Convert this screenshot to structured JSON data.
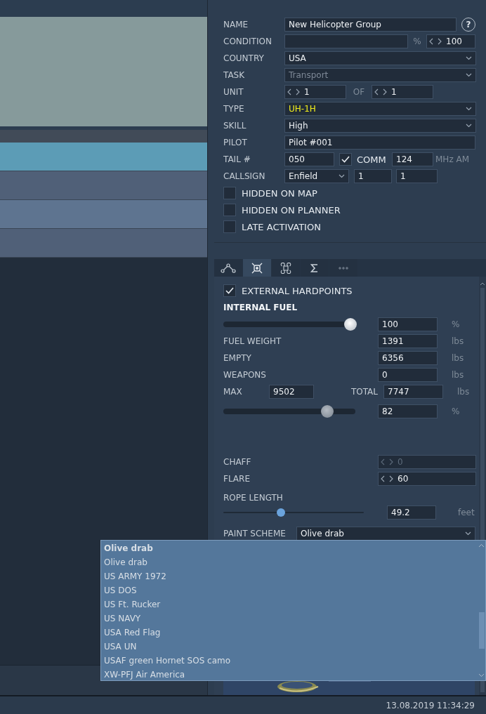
{
  "list_rows": [
    {
      "selected": true
    },
    {
      "selected": false
    },
    {
      "selected": false
    },
    {
      "selected": false
    }
  ],
  "group_form": {
    "name": {
      "label": "NAME",
      "value": "New Helicopter Group",
      "help": "?"
    },
    "condition": {
      "label": "CONDITION",
      "unit": "%",
      "spinner": "100"
    },
    "country": {
      "label": "COUNTRY",
      "value": "USA"
    },
    "task": {
      "label": "TASK",
      "value": "Transport",
      "disabled": true
    },
    "unit": {
      "label": "UNIT",
      "value": "1",
      "of_label": "OF",
      "of_value": "1"
    },
    "type": {
      "label": "TYPE",
      "value": "UH-1H",
      "highlighted": true
    },
    "skill": {
      "label": "SKILL",
      "value": "High"
    },
    "pilot": {
      "label": "PILOT",
      "value": "Pilot #001"
    },
    "tail": {
      "label": "TAIL #",
      "value": "050"
    },
    "comm": {
      "label": "COMM",
      "checked": true,
      "value": "124",
      "unit": "MHz AM"
    },
    "callsign": {
      "label": "CALLSIGN",
      "value": "Enfield",
      "number_1": "1",
      "number_2": "1"
    },
    "options": [
      {
        "label": "HIDDEN ON MAP",
        "checked": false
      },
      {
        "label": "HIDDEN ON PLANNER",
        "checked": false
      },
      {
        "label": "LATE ACTIVATION",
        "checked": false
      }
    ]
  },
  "tabs": [
    {
      "kind": "route",
      "selected": false
    },
    {
      "kind": "payload",
      "selected": true
    },
    {
      "kind": "command",
      "selected": false
    },
    {
      "kind": "sum",
      "selected": false
    },
    {
      "kind": "more",
      "selected": false
    }
  ],
  "payload": {
    "external_hardpoints": {
      "label": "EXTERNAL HARDPOINTS",
      "checked": true
    },
    "internal_fuel": {
      "title": "INTERNAL FUEL",
      "level": 1.0,
      "value": "100",
      "unit": "%"
    },
    "rows": [
      {
        "label": "FUEL WEIGHT",
        "value": "1391",
        "unit": "lbs"
      },
      {
        "label": "EMPTY",
        "value": "6356",
        "unit": "lbs"
      },
      {
        "label": "WEAPONS",
        "value": "0",
        "unit": "lbs"
      }
    ],
    "max": {
      "label": "MAX",
      "value": "9502"
    },
    "total": {
      "label": "TOTAL",
      "value": "7747",
      "unit": "lbs"
    },
    "load": {
      "level": 0.82,
      "value": "82",
      "unit": "%"
    },
    "chaff": {
      "label": "CHAFF",
      "value": "0",
      "disabled": true
    },
    "flare": {
      "label": "FLARE",
      "value": "60",
      "disabled": false
    },
    "rope": {
      "label": "ROPE LENGTH",
      "level": 0.4,
      "value": "49.2",
      "unit": "feet"
    },
    "paint_scheme": {
      "label": "PAINT SCHEME",
      "value": "Olive drab"
    }
  },
  "paint_dropdown": {
    "options": [
      {
        "label": "Olive drab",
        "selected": true
      },
      {
        "label": "Olive drab",
        "selected": false
      },
      {
        "label": "US ARMY 1972",
        "selected": false
      },
      {
        "label": "US DOS",
        "selected": false
      },
      {
        "label": "US Ft. Rucker",
        "selected": false
      },
      {
        "label": "US NAVY",
        "selected": false
      },
      {
        "label": "USA Red Flag",
        "selected": false
      },
      {
        "label": "USA UN",
        "selected": false
      },
      {
        "label": "USAF green Hornet SOS camo",
        "selected": false
      },
      {
        "label": "XW-PFJ Air America",
        "selected": false
      }
    ]
  },
  "status_bar": {
    "datetime": "13.08.2019 11:34:29"
  }
}
